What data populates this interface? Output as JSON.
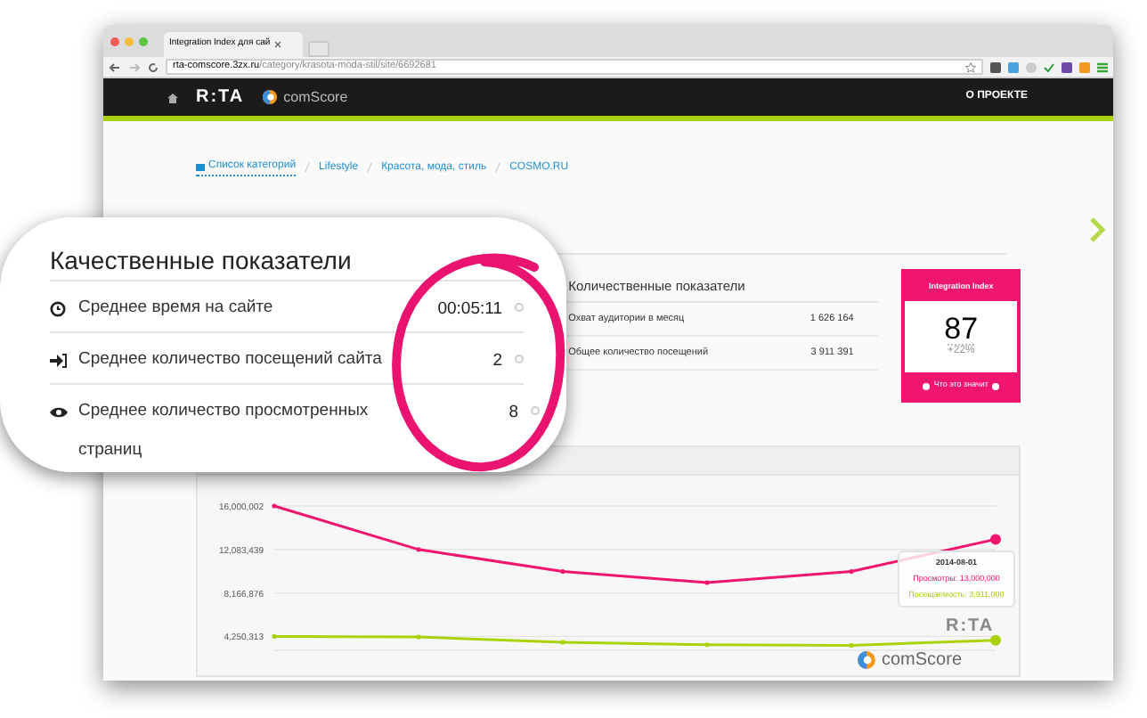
{
  "browser": {
    "tab_title": "Integration Index для сай",
    "url_host": "rta-comscore.3zx.ru",
    "url_path": "/category/krasota-moda-stil/site/6692681"
  },
  "nav": {
    "logos": [
      "R:TA",
      "comScore"
    ],
    "links": [
      "О ПРОЕКТЕ"
    ]
  },
  "breadcrumb": [
    "Список категорий",
    "Lifestyle",
    "Красота, мода, стиль",
    "COSMO.RU"
  ],
  "callout": {
    "title": "Качественные показатели",
    "rows": [
      {
        "kind": "clock",
        "label": "Среднее время на сайте",
        "value": "00:05:11"
      },
      {
        "kind": "visits",
        "label": "Среднее количество посещений сайта",
        "value": "2"
      },
      {
        "kind": "eye",
        "label": "Среднее количество просмотренных страниц",
        "value": "8"
      }
    ]
  },
  "quantitative": {
    "title": "Количественные показатели",
    "rows": [
      {
        "label": "Охват аудитории в месяц",
        "value": "1 626 164"
      },
      {
        "label": "Общее количество посещений",
        "value": "3 911 391"
      }
    ]
  },
  "integration_index": {
    "title": "Integration Index",
    "score": "87",
    "change": "+22%",
    "link": "Что это значит"
  },
  "chart": {
    "chart_data": {
      "type": "line",
      "grid": true,
      "ylim": [
        3000000,
        16000002
      ],
      "yticks": [
        {
          "value": 16000002,
          "label": "16,000,002"
        },
        {
          "value": 12083439,
          "label": "12,083,439"
        },
        {
          "value": 8166876,
          "label": "8,166,876"
        },
        {
          "value": 4250313,
          "label": "4,250,313"
        }
      ],
      "series": [
        {
          "color": "#f0166f",
          "values": [
            16000000,
            12080000,
            10100000,
            9100000,
            10100000,
            13000000
          ]
        },
        {
          "color": "#a9d20b",
          "values": [
            4250000,
            4200000,
            3730000,
            3500000,
            3450000,
            3911000
          ]
        }
      ]
    },
    "tooltip": {
      "date": "2014-08-01",
      "lines": [
        {
          "label": "Просмотры:",
          "value": "13,000,000"
        },
        {
          "label": "Посещаемость:",
          "value": "3,911,000"
        }
      ]
    },
    "logos": [
      "R:TA",
      "comScore"
    ]
  }
}
